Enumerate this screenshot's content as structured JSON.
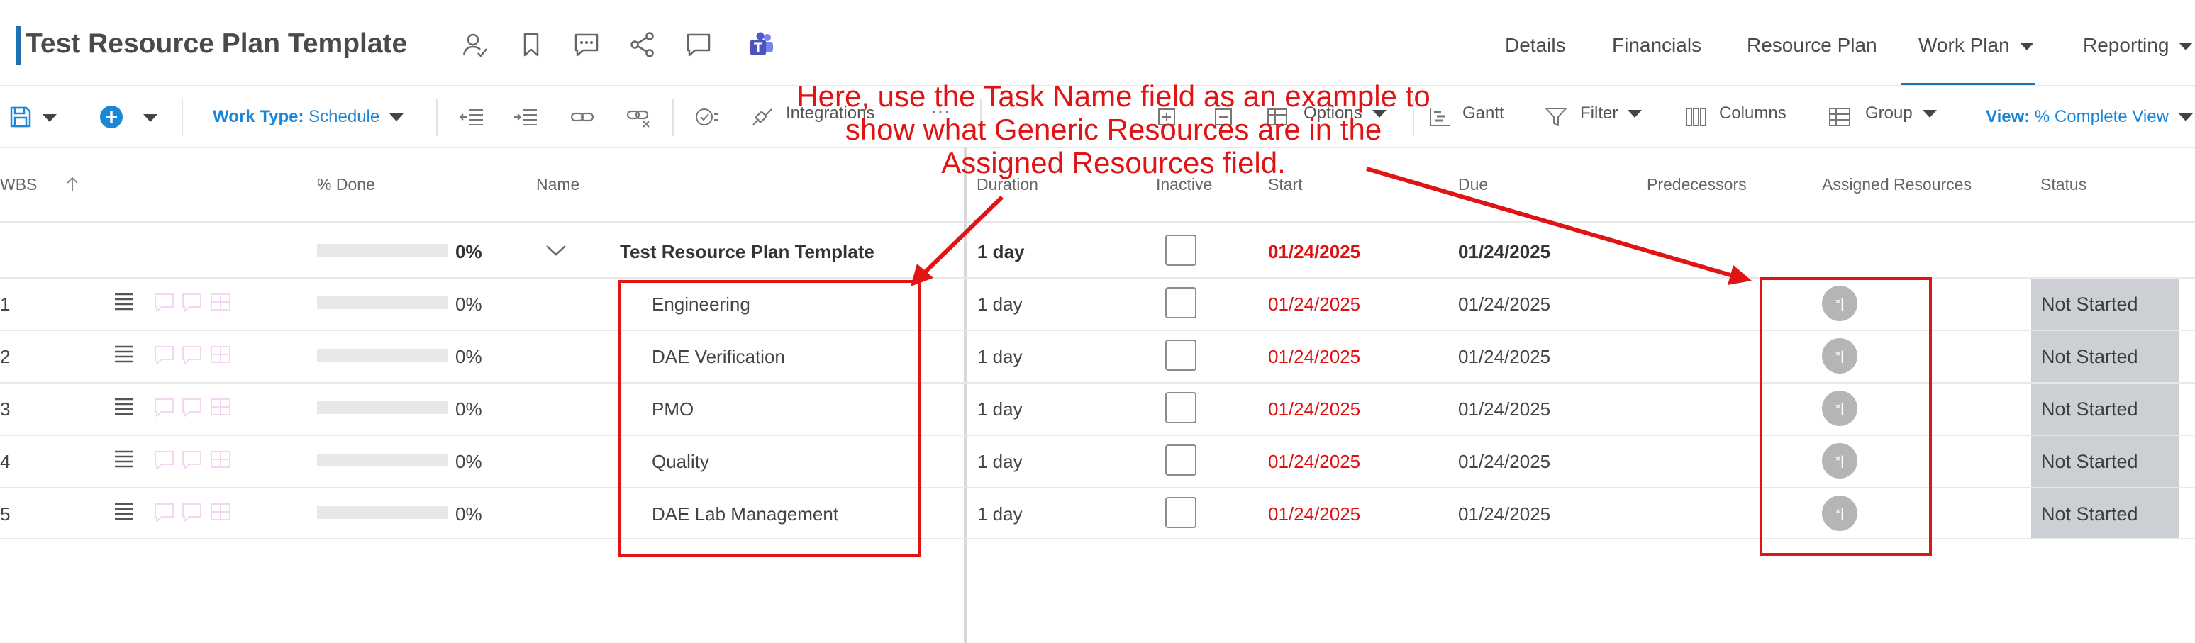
{
  "header": {
    "title": "Test Resource Plan Template",
    "icons": [
      "user-icon",
      "bookmark-icon",
      "comment-icon",
      "share-icon",
      "chat-icon",
      "teams-icon"
    ],
    "nav": [
      {
        "label": "Details"
      },
      {
        "label": "Financials"
      },
      {
        "label": "Resource Plan"
      },
      {
        "label": "Work Plan",
        "active": true
      },
      {
        "label": "Reporting"
      }
    ],
    "accent_color": "#1f6fb5"
  },
  "toolbar": {
    "work_type_prefix": "Work Type:",
    "work_type_value": "Schedule",
    "integrations": "Integrations",
    "options": "Options",
    "gantt": "Gantt",
    "filter": "Filter",
    "columns": "Columns",
    "group": "Group",
    "view_prefix": "View:",
    "view_value": "% Complete View"
  },
  "grid": {
    "columns": {
      "wbs": "WBS",
      "done": "% Done",
      "name": "Name",
      "duration": "Duration",
      "inactive": "Inactive",
      "start": "Start",
      "due": "Due",
      "predecessors": "Predecessors",
      "assigned": "Assigned Resources",
      "status": "Status"
    },
    "summary": {
      "done": "0%",
      "name": "Test Resource Plan Template",
      "duration": "1 day",
      "start": "01/24/2025",
      "due": "01/24/2025"
    },
    "rows": [
      {
        "wbs": "1",
        "done": "0%",
        "name": "Engineering",
        "duration": "1 day",
        "start": "01/24/2025",
        "due": "01/24/2025",
        "avatar": "*|",
        "status": "Not Started"
      },
      {
        "wbs": "2",
        "done": "0%",
        "name": "DAE Verification",
        "duration": "1 day",
        "start": "01/24/2025",
        "due": "01/24/2025",
        "avatar": "*|",
        "status": "Not Started"
      },
      {
        "wbs": "3",
        "done": "0%",
        "name": "PMO",
        "duration": "1 day",
        "start": "01/24/2025",
        "due": "01/24/2025",
        "avatar": "*|",
        "status": "Not Started"
      },
      {
        "wbs": "4",
        "done": "0%",
        "name": "Quality",
        "duration": "1 day",
        "start": "01/24/2025",
        "due": "01/24/2025",
        "avatar": "*|",
        "status": "Not Started"
      },
      {
        "wbs": "5",
        "done": "0%",
        "name": "DAE Lab Management",
        "duration": "1 day",
        "start": "01/24/2025",
        "due": "01/24/2025",
        "avatar": "*|",
        "status": "Not Started"
      }
    ]
  },
  "annotation": {
    "line1": "Here, use the Task Name field as an example to",
    "line2": "show what Generic Resources are in the",
    "line3": "Assigned Resources field.",
    "color": "#e01414"
  }
}
